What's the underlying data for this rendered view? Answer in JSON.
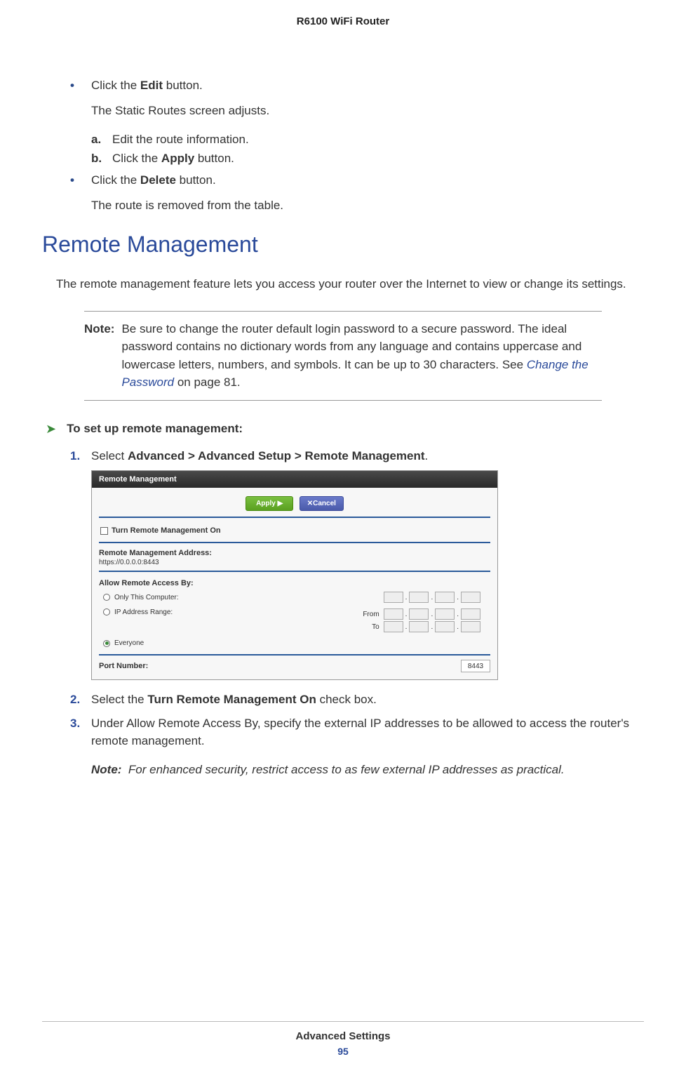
{
  "header": {
    "title": "R6100 WiFi Router"
  },
  "intro_bullets": {
    "b1": {
      "pre": "Click the ",
      "bold": "Edit",
      "post": " button."
    },
    "b1_sub": "The Static Routes screen adjusts.",
    "b1_a": "Edit the route information.",
    "b1_b": {
      "pre": "Click the ",
      "bold": "Apply",
      "post": " button."
    },
    "b2": {
      "pre": "Click the ",
      "bold": "Delete",
      "post": " button."
    },
    "b2_sub": "The route is removed from the table."
  },
  "section": {
    "heading": "Remote Management",
    "intro": "The remote management feature lets you access your router over the Internet to view or change its settings."
  },
  "note": {
    "label": "Note:",
    "text_part1": "Be sure to change the router default login password to a secure password. The ideal password contains no dictionary words from any language and contains uppercase and lowercase letters, numbers, and symbols. It can be up to 30 characters. See ",
    "link": "Change the Password",
    "text_part2": " on page 81."
  },
  "procedure": {
    "title": "To set up remote management:",
    "steps": {
      "s1": {
        "pre": "Select ",
        "bold": "Advanced > Advanced Setup > Remote Management",
        "post": "."
      },
      "s2": {
        "pre": "Select the ",
        "bold": "Turn Remote Management On",
        "post": " check box."
      },
      "s3": "Under Allow Remote Access By, specify the external IP addresses to be allowed to access the router's remote management."
    },
    "inline_note": {
      "label": "Note:",
      "text": "For enhanced security, restrict access to as few external IP addresses as practical."
    }
  },
  "screenshot": {
    "title": "Remote Management",
    "apply": "Apply ▶",
    "cancel": "✕Cancel",
    "turn_on": "Turn Remote Management On",
    "addr_label": "Remote Management Address:",
    "addr_value": "https://0.0.0.0:8443",
    "allow_label": "Allow Remote Access By:",
    "only_this": "Only This Computer:",
    "ip_range": "IP Address Range:",
    "from": "From",
    "to": "To",
    "everyone": "Everyone",
    "port_label": "Port Number:",
    "port_value": "8443"
  },
  "footer": {
    "title": "Advanced Settings",
    "page": "95"
  }
}
